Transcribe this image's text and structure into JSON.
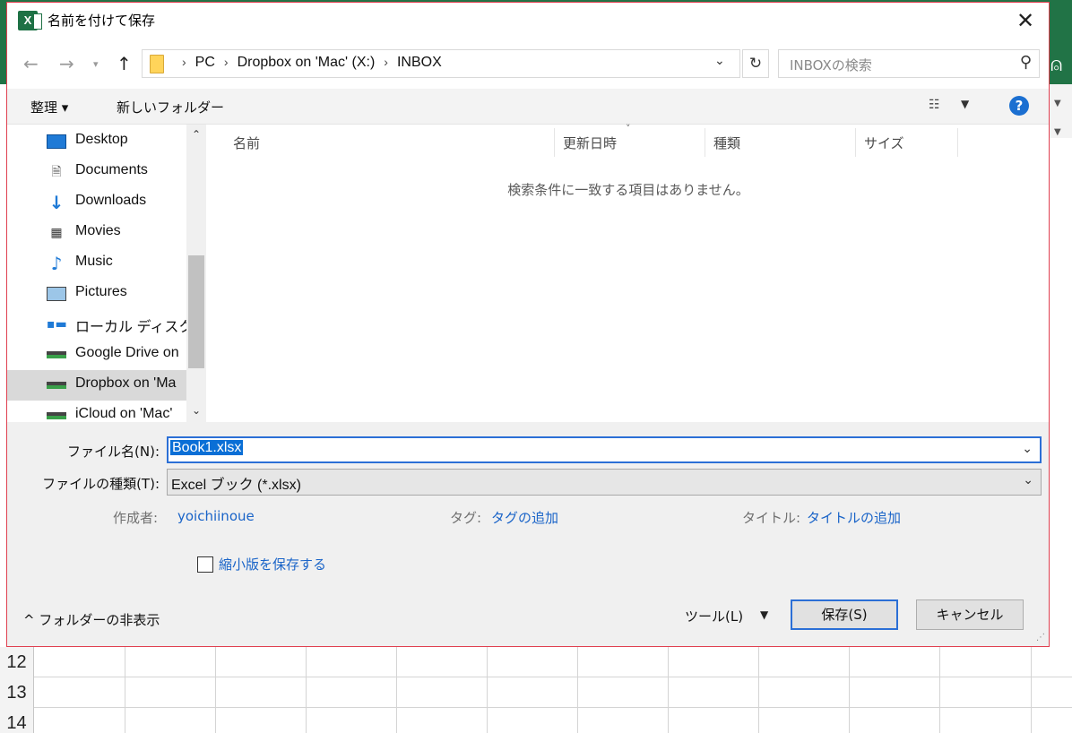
{
  "dialog": {
    "title": "名前を付けて保存",
    "app_icon_label": "X",
    "close_glyph": "✕"
  },
  "address": {
    "crumbs": [
      "PC",
      "Dropbox on 'Mac' (X:)",
      "INBOX"
    ],
    "search_placeholder": "INBOXの検索"
  },
  "toolbar": {
    "organize_label": "整理 ▾",
    "new_folder_label": "新しいフォルダー",
    "help_glyph": "?"
  },
  "nav_pane": {
    "items": [
      {
        "label": "Desktop",
        "icon": "desktop-icon"
      },
      {
        "label": "Documents",
        "icon": "documents-icon"
      },
      {
        "label": "Downloads",
        "icon": "downloads-icon"
      },
      {
        "label": "Movies",
        "icon": "movies-icon"
      },
      {
        "label": "Music",
        "icon": "music-icon"
      },
      {
        "label": "Pictures",
        "icon": "pictures-icon"
      },
      {
        "label": "ローカル ディスク (C",
        "icon": "local-disk-icon"
      },
      {
        "label": "Google Drive on",
        "icon": "network-drive-icon"
      },
      {
        "label": "Dropbox on 'Ma",
        "icon": "network-drive-icon",
        "selected": true
      },
      {
        "label": "iCloud on 'Mac'",
        "icon": "network-drive-icon"
      }
    ]
  },
  "file_list": {
    "columns": [
      "名前",
      "更新日時",
      "種類",
      "サイズ"
    ],
    "empty_message": "検索条件に一致する項目はありません。"
  },
  "form": {
    "filename_label": "ファイル名(N):",
    "filename_value": "Book1.xlsx",
    "filetype_label": "ファイルの種類(T):",
    "filetype_value": "Excel ブック (*.xlsx)",
    "author_label": "作成者:",
    "author_value": "yoichiinoue",
    "tags_label": "タグ:",
    "tags_value": "タグの追加",
    "title_label": "タイトル:",
    "title_value": "タイトルの追加",
    "thumbnail_label": "縮小版を保存する",
    "thumbnail_checked": false
  },
  "footer": {
    "hide_folders_label": "^ フォルダーの非表示",
    "tools_label": "ツール(L)",
    "save_label": "保存(S)",
    "cancel_label": "キャンセル"
  },
  "excel": {
    "row_numbers": [
      "12",
      "13",
      "14"
    ],
    "ribbon_color": "#217346"
  }
}
